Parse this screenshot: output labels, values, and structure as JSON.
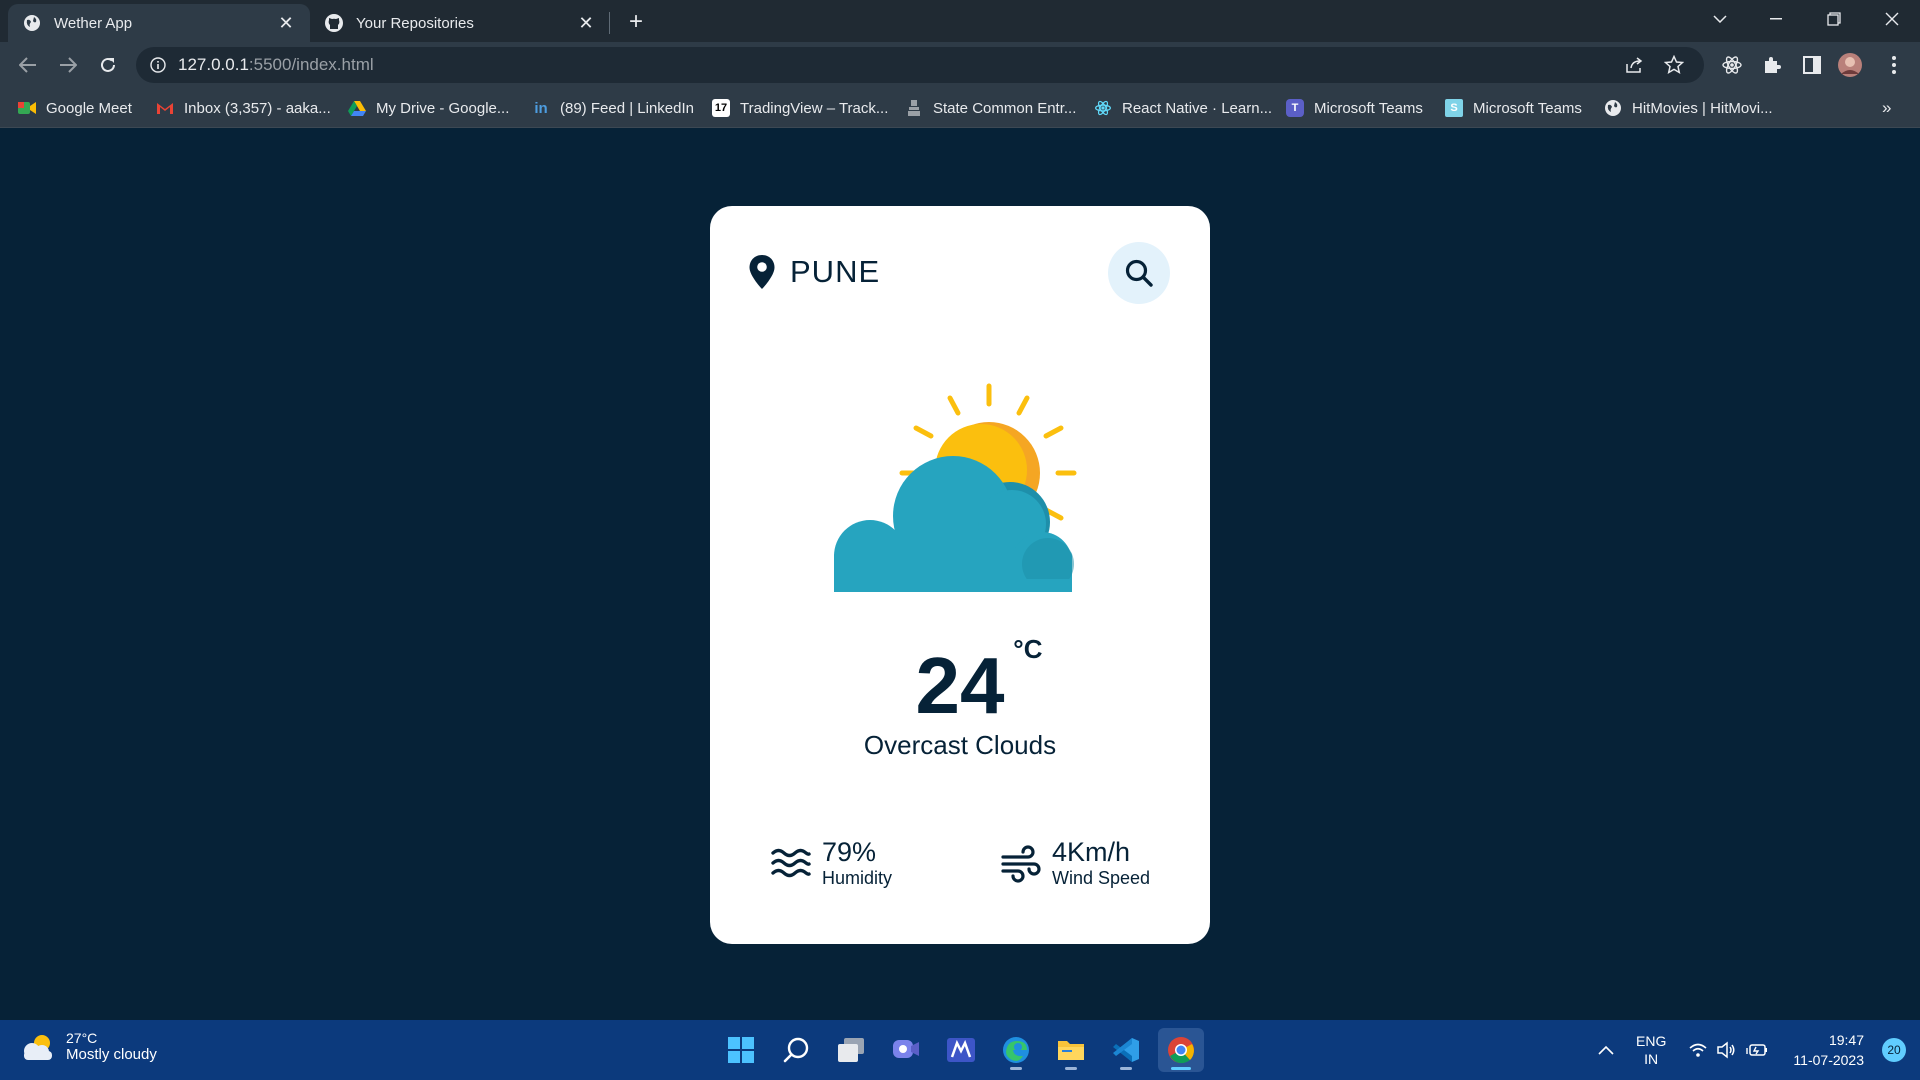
{
  "browser": {
    "tabs": [
      {
        "title": "Wether App",
        "icon": "globe-icon",
        "active": true
      },
      {
        "title": "Your Repositories",
        "icon": "github-icon",
        "active": false
      }
    ],
    "url": {
      "host": "127.0.0.1",
      "rest": ":5500/index.html"
    },
    "bookmarks": [
      {
        "label": "Google Meet",
        "icon": "google-meet-icon"
      },
      {
        "label": "Inbox (3,357) - aaka...",
        "icon": "gmail-icon"
      },
      {
        "label": "My Drive - Google...",
        "icon": "google-drive-icon"
      },
      {
        "label": "(89) Feed | LinkedIn",
        "icon": "linkedin-icon"
      },
      {
        "label": "TradingView – Track...",
        "icon": "tradingview-icon"
      },
      {
        "label": "State Common Entr...",
        "icon": "emblem-icon"
      },
      {
        "label": "React Native · Learn...",
        "icon": "react-icon"
      },
      {
        "label": "Microsoft Teams",
        "icon": "teams-icon"
      },
      {
        "label": "Microsoft Teams",
        "icon": "teams-s-icon"
      },
      {
        "label": "HitMovies | HitMovi...",
        "icon": "globe-icon"
      }
    ],
    "bookmarks_overflow": "»"
  },
  "weather": {
    "city": "PUNE",
    "temperature": "24",
    "unit": "°C",
    "description": "Overcast Clouds",
    "humidity_value": "79%",
    "humidity_label": "Humidity",
    "wind_value": "4Km/h",
    "wind_label": "Wind Speed",
    "icon": "sun-behind-cloud-icon"
  },
  "taskbar": {
    "weather_temp": "27°C",
    "weather_desc": "Mostly cloudy",
    "lang_line1": "ENG",
    "lang_line2": "IN",
    "time": "19:47",
    "date": "11-07-2023",
    "notifications": "20"
  },
  "colors": {
    "page_bg": "#062237",
    "card_bg": "#ffffff",
    "accent_dark": "#062237",
    "search_bg": "#e3f2fb",
    "sun": "#fbbf0e",
    "cloud": "#26a4bf",
    "taskbar": "#0c3a7d"
  }
}
